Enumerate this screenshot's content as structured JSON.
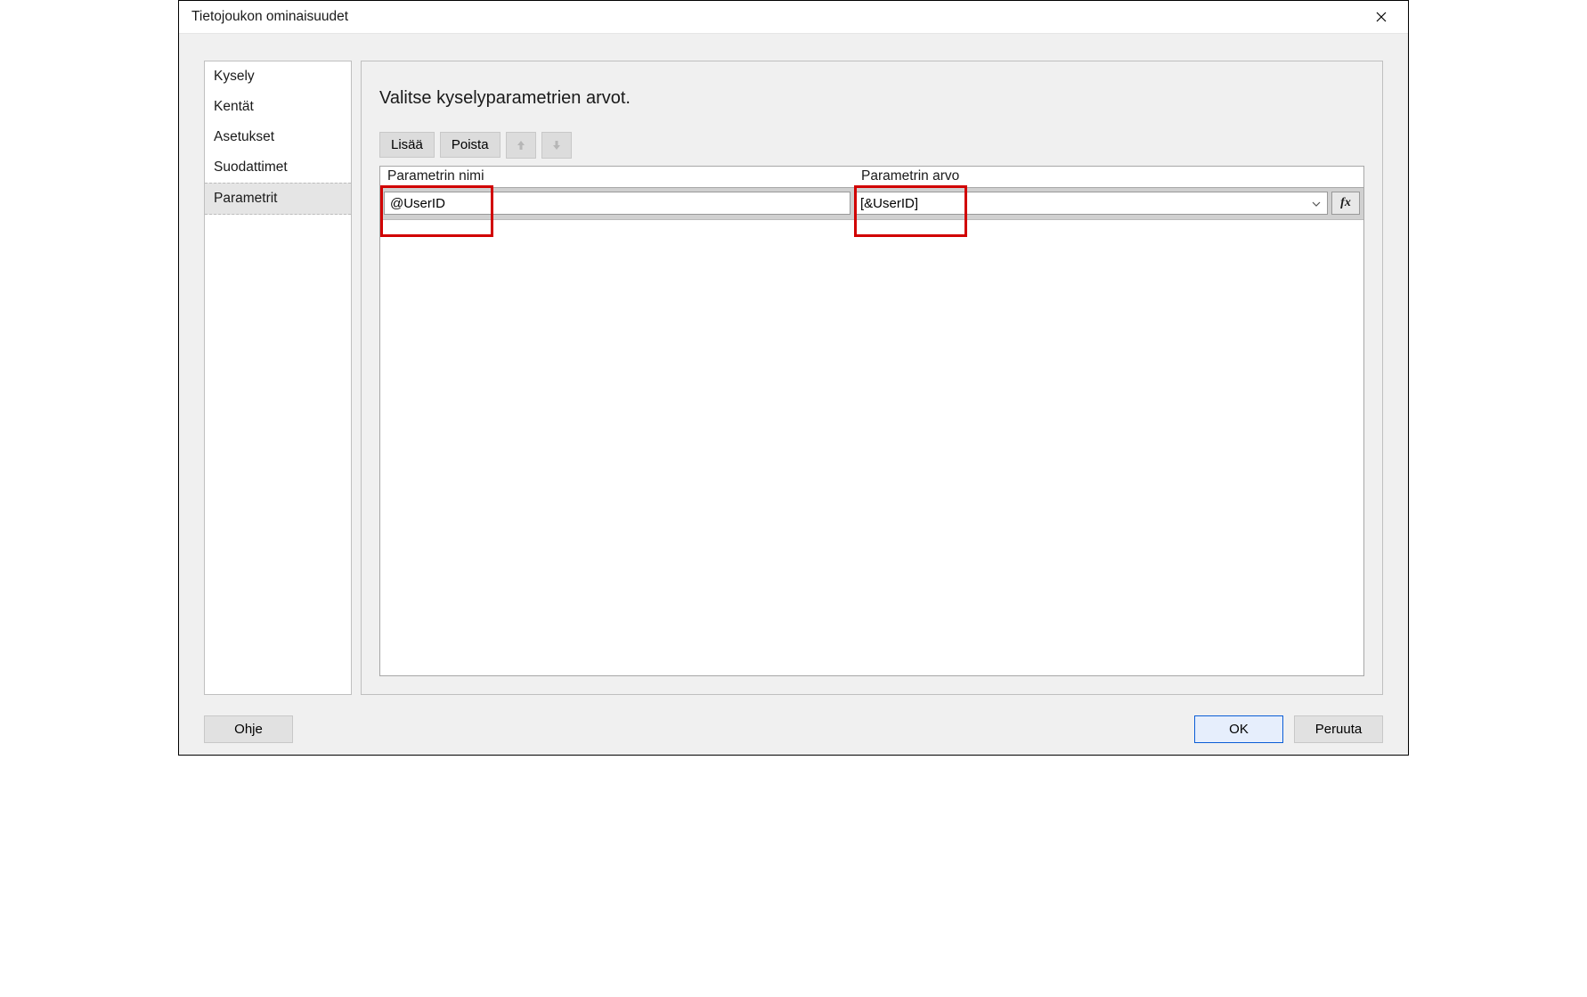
{
  "dialog": {
    "title": "Tietojoukon ominaisuudet"
  },
  "sidebar": {
    "items": [
      {
        "label": "Kysely",
        "selected": false
      },
      {
        "label": "Kentät",
        "selected": false
      },
      {
        "label": "Asetukset",
        "selected": false
      },
      {
        "label": "Suodattimet",
        "selected": false
      },
      {
        "label": "Parametrit",
        "selected": true
      }
    ]
  },
  "content": {
    "heading": "Valitse kyselyparametrien arvot.",
    "toolbar": {
      "add_label": "Lisää",
      "delete_label": "Poista"
    },
    "grid": {
      "header_name": "Parametrin nimi",
      "header_value": "Parametrin arvo",
      "rows": [
        {
          "name": "@UserID",
          "value": "[&UserID]"
        }
      ],
      "fx_label": "fx"
    }
  },
  "footer": {
    "help_label": "Ohje",
    "ok_label": "OK",
    "cancel_label": "Peruuta"
  }
}
